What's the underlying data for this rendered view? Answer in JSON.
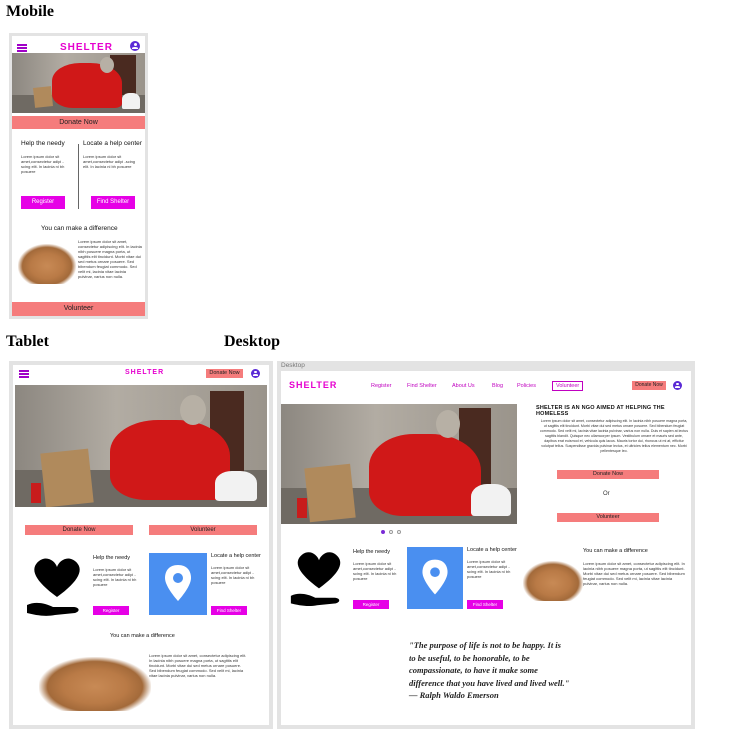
{
  "sections": {
    "mobile": "Mobile",
    "tablet": "Tablet",
    "desktop": "Desktop"
  },
  "frame_label": "Desktop",
  "brand": "SHELTER",
  "colors": {
    "brand": "#e600cf",
    "accent_bar": "#f57c7c",
    "button": "#e600e6",
    "avatar": "#5b2bd6",
    "map_tile": "#4a8ff0"
  },
  "buttons": {
    "donate": "Donate Now",
    "volunteer": "Volunteer",
    "register": "Register",
    "find_shelter": "Find Shelter",
    "or": "Or"
  },
  "cards": {
    "help_needy": "Help the needy",
    "locate": "Locate a help center",
    "difference": "You can make a difference"
  },
  "lorem": {
    "short": "Lorem ipsum dolor sit amet,consectetur adipi -scing elit. In lacinia ni bh posuere",
    "long": "Lorem ipsum dolor sit amet, consectetur adipiscing elit. In lacinia nibh posuere magna porta, ut sagittis elit tincidunt. Morbi vitae dui sed metus ornare posuere. Sed bibendum feugiat commodo. Sed velit mi, lacinia vitae lacinia pulvinar, varius non nulla.",
    "ngo": "Lorem ipsum dolor sit amet, consectetur adipiscing elit. In lacinia nibh posuere magna porta, ut sagittis elit tincidunt. Morbi vitae dui sed metus ornare posuere. Sed bibendum feugiat commodo. Sed velit mi, lacinia vitae lacinia pulvinar, varius non nulla. Duis et sapien at lectus sagittis blandit. Quisque nec ullamcorper ipsum. Vestibulum ornare et mauris sed ante, dapibus erat euismod et, vehicula quis lacus. Mauris tortor dui, rhoncus ut mi at, efficitur volutpat tellus. Suspendisse gravida pulvinar lectus, et ultricies tellus elementum nec. Morbi pellentesque leo."
  },
  "desktop": {
    "nav": [
      "Register",
      "Find Shelter",
      "About Us",
      "Blog",
      "Policies",
      "Volunteer"
    ],
    "headline": "SHELTER IS AN NGO AIMED AT HELPING THE HOMELESS",
    "quote_lines": [
      "\"The purpose of life is not to be happy. It is",
      "to be  useful, to be honorable, to be",
      "compassionate, to have it make some",
      "difference that you have lived and lived well.\"",
      "— Ralph Waldo Emerson"
    ]
  },
  "carousel": {
    "slides": 3,
    "active": 1
  }
}
